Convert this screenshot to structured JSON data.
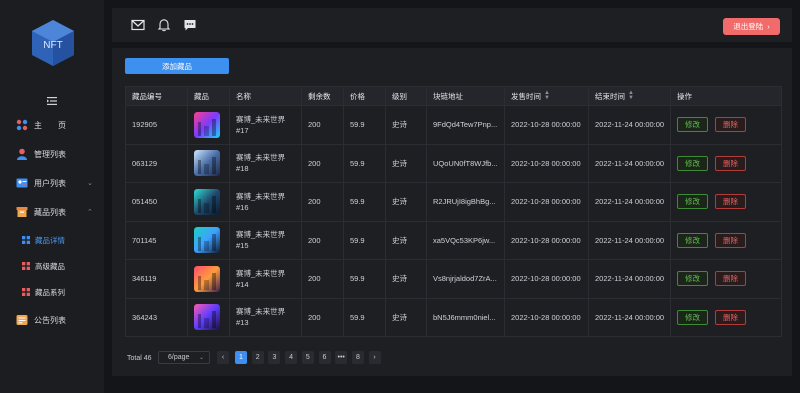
{
  "sidebar": {
    "logo_text": "NFT",
    "items": [
      {
        "label": "主　　页",
        "icon": "home-icon"
      },
      {
        "label": "管理列表",
        "icon": "user-icon"
      },
      {
        "label": "用户列表",
        "icon": "user-card-icon",
        "caret": "⌄"
      },
      {
        "label": "藏品列表",
        "icon": "collection-box-icon",
        "caret": "⌃"
      },
      {
        "label": "藏品详情",
        "icon": "grid-icon",
        "active": true
      },
      {
        "label": "高级藏品",
        "icon": "grid-icon"
      },
      {
        "label": "藏品系列",
        "icon": "grid-icon"
      },
      {
        "label": "公告列表",
        "icon": "announcement-icon"
      }
    ]
  },
  "header": {
    "logout_label": "退出登陆",
    "logout_arrow": "›"
  },
  "main": {
    "add_label": "添加藏品",
    "columns": [
      "藏品编号",
      "藏品",
      "名称",
      "剩余数",
      "价格",
      "级别",
      "块链地址",
      "发售时间",
      "结束时间",
      "操作"
    ],
    "rows": [
      {
        "id": "192905",
        "name": "赛博_未来世界#17",
        "remain": "200",
        "price": "59.9",
        "level": "史诗",
        "address": "9FdQd4Tew7Pnp...",
        "start": "2022-10-28 00:00:00",
        "end": "2022-11-24 00:00:00"
      },
      {
        "id": "063129",
        "name": "赛博_未来世界#18",
        "remain": "200",
        "price": "59.9",
        "level": "史诗",
        "address": "UQoUN0fT8WJfb...",
        "start": "2022-10-28 00:00:00",
        "end": "2022-11-24 00:00:00"
      },
      {
        "id": "051450",
        "name": "赛博_未来世界#16",
        "remain": "200",
        "price": "59.9",
        "level": "史诗",
        "address": "R2JRUjI8igBhBg...",
        "start": "2022-10-28 00:00:00",
        "end": "2022-11-24 00:00:00"
      },
      {
        "id": "701145",
        "name": "赛博_未来世界#15",
        "remain": "200",
        "price": "59.9",
        "level": "史诗",
        "address": "xa5VQc53KP6jw...",
        "start": "2022-10-28 00:00:00",
        "end": "2022-11-24 00:00:00"
      },
      {
        "id": "346119",
        "name": "赛博_未来世界#14",
        "remain": "200",
        "price": "59.9",
        "level": "史诗",
        "address": "Vs8njrjaldod7ZrA...",
        "start": "2022-10-28 00:00:00",
        "end": "2022-11-24 00:00:00"
      },
      {
        "id": "364243",
        "name": "赛博_未来世界#13",
        "remain": "200",
        "price": "59.9",
        "level": "史诗",
        "address": "bN5J6mmm0niel...",
        "start": "2022-10-28 00:00:00",
        "end": "2022-11-24 00:00:00"
      }
    ],
    "edit_label": "修改",
    "delete_label": "删除"
  },
  "pagination": {
    "total": "Total 46",
    "page_size": "6/page",
    "prev": "‹",
    "next": "›",
    "pages": [
      "1",
      "2",
      "3",
      "4",
      "5",
      "6",
      "•••",
      "8"
    ],
    "current": "1"
  },
  "colors": {
    "accent": "#3d8ff0",
    "logout": "#f26b6b",
    "edit": "#5fbf4e",
    "delete": "#e86060"
  }
}
